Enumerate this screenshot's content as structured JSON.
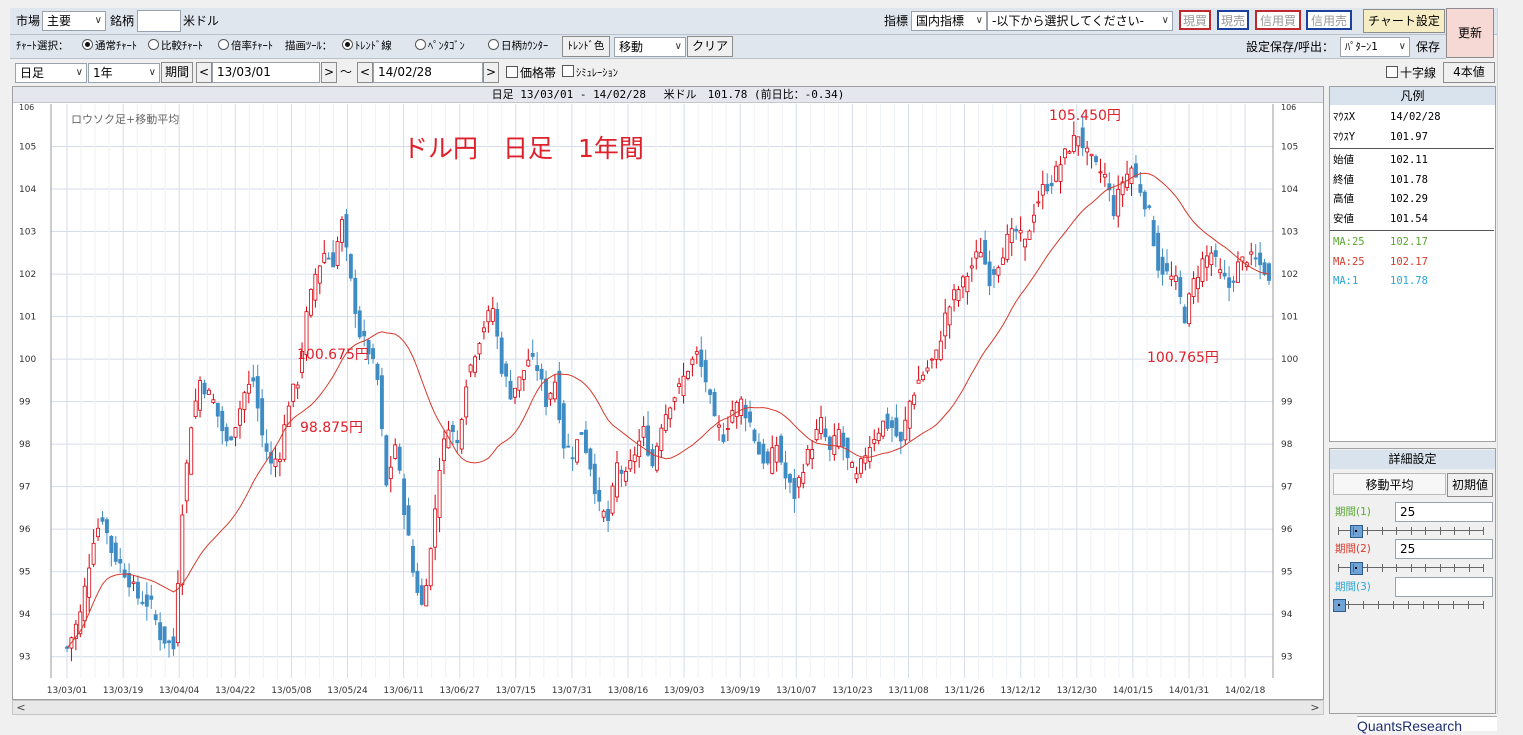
{
  "toolbar1": {
    "market_label": "市場",
    "market_value": "主要",
    "symbol_label": "銘柄",
    "symbol_value": "",
    "symbol_name": "米ドル",
    "indicator_label": "指標",
    "indicator_value": "国内指標",
    "indicator_select": "-以下から選択してください-",
    "buy_spot": "現買",
    "sell_spot": "現売",
    "buy_credit": "信用買",
    "sell_credit": "信用売",
    "chart_settings": "チャート設定",
    "refresh": "更新"
  },
  "toolbar2": {
    "chart_select_label": "ﾁｬｰﾄ選択：",
    "chart_types": [
      "通常ﾁｬｰﾄ",
      "比較ﾁｬｰﾄ",
      "倍率ﾁｬｰﾄ"
    ],
    "draw_tool_label": "描画ﾂｰﾙ：",
    "draw_tools": [
      "ﾄﾚﾝﾄﾞ線",
      "ﾍﾟﾝﾀｺﾞﾝ",
      "日柄ｶｳﾝﾀｰ"
    ],
    "trend_color": "ﾄﾚﾝﾄﾞ色",
    "mode_value": "移動",
    "clear": "クリア",
    "save_label": "設定保存/呼出：",
    "pattern_value": "ﾊﾟﾀｰﾝ1",
    "save": "保存"
  },
  "toolbar3": {
    "interval_value": "日足",
    "span_value": "1年",
    "period_btn": "期間",
    "prev": "<",
    "next": ">",
    "start_date": "13/03/01",
    "tilde": "〜",
    "end_date": "14/02/28",
    "price_band": "価格帯",
    "simulation": "ｼﾐｭﾚｰｼｮﾝ",
    "crosshair": "十字線",
    "four_values": "4本値"
  },
  "chart_header": "日足 13/03/01 - 14/02/28　 米ドル　101.78 (前日比：-0.34)",
  "chart_inner_label": "ロウソク足+移動平均",
  "chart_data": {
    "type": "candlestick",
    "title": "ドル円　日足　1年間",
    "ylim": [
      92.5,
      106
    ],
    "y_ticks": [
      93,
      94,
      95,
      96,
      97,
      98,
      99,
      100,
      101,
      102,
      103,
      104,
      105
    ],
    "y_top_tick": "106",
    "x_tick_labels": [
      "13/03/01",
      "13/03/19",
      "13/04/04",
      "13/04/22",
      "13/05/08",
      "13/05/24",
      "13/06/11",
      "13/06/27",
      "13/07/15",
      "13/07/31",
      "13/08/16",
      "13/09/03",
      "13/09/19",
      "13/10/07",
      "13/10/23",
      "13/11/08",
      "13/11/26",
      "13/12/12",
      "13/12/30",
      "14/01/15",
      "14/01/31",
      "14/02/18"
    ],
    "approx_closes": [
      [
        0,
        93.2
      ],
      [
        3,
        94.0
      ],
      [
        6,
        95.8
      ],
      [
        8,
        96.3
      ],
      [
        10,
        95.5
      ],
      [
        13,
        95.0
      ],
      [
        16,
        94.4
      ],
      [
        19,
        94.2
      ],
      [
        21,
        93.5
      ],
      [
        24,
        93.2
      ],
      [
        26,
        96.5
      ],
      [
        28,
        98.5
      ],
      [
        30,
        99.5
      ],
      [
        33,
        99.0
      ],
      [
        36,
        98.0
      ],
      [
        38,
        98.5
      ],
      [
        40,
        99.2
      ],
      [
        42,
        99.5
      ],
      [
        44,
        98.2
      ],
      [
        46,
        97.5
      ],
      [
        48,
        97.8
      ],
      [
        50,
        99.0
      ],
      [
        52,
        99.5
      ],
      [
        54,
        101.0
      ],
      [
        56,
        102.0
      ],
      [
        58,
        102.5
      ],
      [
        60,
        102.3
      ],
      [
        62,
        103.2
      ],
      [
        64,
        101.8
      ],
      [
        66,
        100.6
      ],
      [
        68,
        100.2
      ],
      [
        70,
        99.5
      ],
      [
        72,
        97.0
      ],
      [
        74,
        98.0
      ],
      [
        76,
        96.5
      ],
      [
        78,
        95.0
      ],
      [
        80,
        94.2
      ],
      [
        82,
        95.5
      ],
      [
        84,
        97.5
      ],
      [
        86,
        98.5
      ],
      [
        88,
        98.0
      ],
      [
        90,
        99.5
      ],
      [
        92,
        100.2
      ],
      [
        94,
        100.8
      ],
      [
        96,
        101.2
      ],
      [
        98,
        99.8
      ],
      [
        100,
        99.2
      ],
      [
        102,
        99.5
      ],
      [
        104,
        100.0
      ],
      [
        106,
        99.8
      ],
      [
        108,
        99.0
      ],
      [
        110,
        99.5
      ],
      [
        112,
        98.0
      ],
      [
        114,
        97.8
      ],
      [
        116,
        98.3
      ],
      [
        118,
        97.5
      ],
      [
        120,
        96.5
      ],
      [
        122,
        96.2
      ],
      [
        124,
        97.5
      ],
      [
        126,
        97.2
      ],
      [
        128,
        97.8
      ],
      [
        130,
        98.3
      ],
      [
        132,
        97.5
      ],
      [
        134,
        98.5
      ],
      [
        136,
        99.0
      ],
      [
        138,
        99.3
      ],
      [
        140,
        99.8
      ],
      [
        142,
        100.1
      ],
      [
        144,
        99.5
      ],
      [
        146,
        98.5
      ],
      [
        148,
        98.2
      ],
      [
        150,
        98.8
      ],
      [
        152,
        99.0
      ],
      [
        154,
        98.5
      ],
      [
        156,
        97.8
      ],
      [
        158,
        97.5
      ],
      [
        160,
        98.0
      ],
      [
        162,
        97.2
      ],
      [
        164,
        96.8
      ],
      [
        166,
        97.5
      ],
      [
        168,
        98.0
      ],
      [
        170,
        98.5
      ],
      [
        172,
        97.8
      ],
      [
        174,
        98.3
      ],
      [
        176,
        97.6
      ],
      [
        178,
        97.2
      ],
      [
        180,
        97.8
      ],
      [
        182,
        98.2
      ],
      [
        184,
        98.5
      ],
      [
        186,
        98.4
      ],
      [
        188,
        98.0
      ],
      [
        190,
        99.0
      ],
      [
        192,
        99.5
      ],
      [
        194,
        99.8
      ],
      [
        196,
        100.1
      ],
      [
        198,
        101.0
      ],
      [
        200,
        101.5
      ],
      [
        202,
        101.8
      ],
      [
        204,
        102.2
      ],
      [
        206,
        102.6
      ],
      [
        208,
        101.9
      ],
      [
        210,
        102.3
      ],
      [
        212,
        102.8
      ],
      [
        214,
        103.0
      ],
      [
        216,
        102.7
      ],
      [
        218,
        103.5
      ],
      [
        220,
        104.0
      ],
      [
        222,
        104.2
      ],
      [
        224,
        104.6
      ],
      [
        226,
        105.0
      ],
      [
        228,
        105.3
      ],
      [
        230,
        104.8
      ],
      [
        232,
        104.5
      ],
      [
        234,
        104.3
      ],
      [
        236,
        103.5
      ],
      [
        238,
        104.2
      ],
      [
        240,
        104.5
      ],
      [
        242,
        104.0
      ],
      [
        244,
        103.4
      ],
      [
        246,
        102.2
      ],
      [
        248,
        102.0
      ],
      [
        250,
        101.8
      ],
      [
        252,
        101.0
      ],
      [
        254,
        101.8
      ],
      [
        256,
        102.3
      ],
      [
        258,
        102.5
      ],
      [
        260,
        102.0
      ],
      [
        262,
        101.7
      ],
      [
        264,
        102.2
      ],
      [
        266,
        102.4
      ],
      [
        268,
        102.3
      ],
      [
        270,
        102.1
      ],
      [
        271,
        101.78
      ]
    ],
    "annotations": [
      "105.450円",
      "100.675円",
      "98.875円",
      "100.765円"
    ],
    "colors": {
      "up": "#d8000b",
      "down": "#3f8cc4",
      "ma": "#d73a2c",
      "title": "#e0202a"
    }
  },
  "legend": {
    "title": "凡例",
    "rows": [
      {
        "k": "ﾏｳｽX",
        "v": "14/02/28"
      },
      {
        "k": "ﾏｳｽY",
        "v": "101.97"
      },
      {
        "k": "始値",
        "v": "102.11"
      },
      {
        "k": "終値",
        "v": "101.78"
      },
      {
        "k": "高値",
        "v": "102.29"
      },
      {
        "k": "安値",
        "v": "101.54"
      }
    ],
    "ma_rows": [
      {
        "k": "MA:25",
        "v": "102.17",
        "color": "#5aa832"
      },
      {
        "k": "MA:25",
        "v": "102.17",
        "color": "#d73a2c"
      },
      {
        "k": "MA:1",
        "v": "101.78",
        "color": "#2aa6d8"
      }
    ]
  },
  "detail": {
    "title": "詳細設定",
    "tab": "移動平均",
    "reset": "初期値",
    "p1_label": "期間(1)",
    "p1_value": "25",
    "p1_color": "#5aa832",
    "p2_label": "期間(2)",
    "p2_value": "25",
    "p2_color": "#d73a2c",
    "p3_label": "期間(3)",
    "p3_value": "",
    "p3_color": "#2aa6d8"
  },
  "footer_logo": "QuantsResearch"
}
